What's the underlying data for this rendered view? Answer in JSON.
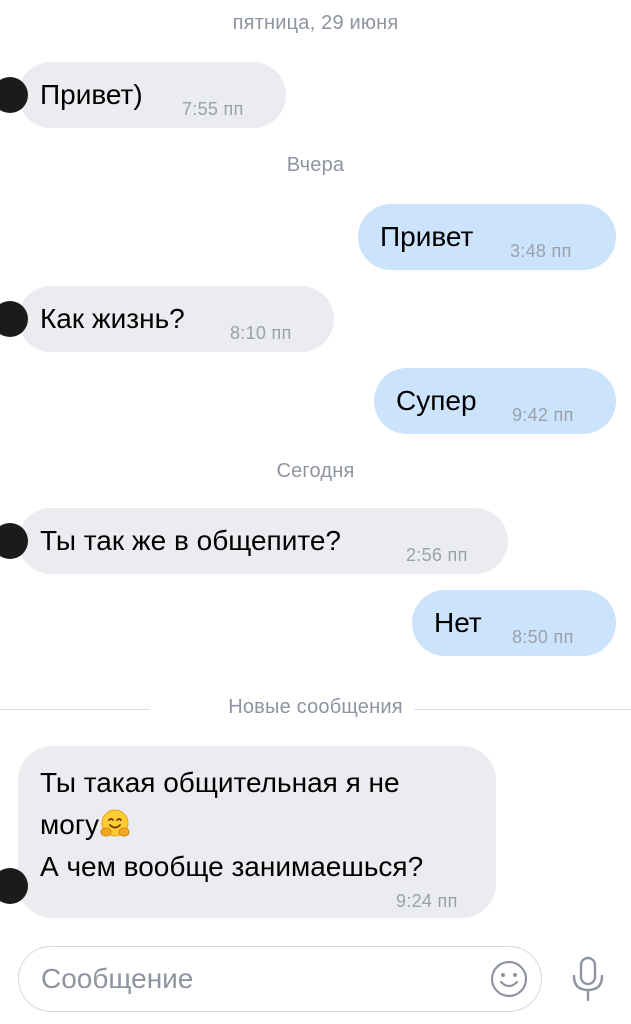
{
  "chat": {
    "separators": {
      "friday": "пятница, 29 июня",
      "yesterday": "Вчера",
      "today": "Сегодня"
    },
    "messages": [
      {
        "text": "Привет)",
        "time": "7:55 пп",
        "direction": "in"
      },
      {
        "text": "Привет",
        "time": "3:48 пп",
        "direction": "out"
      },
      {
        "text": "Как жизнь?",
        "time": "8:10 пп",
        "direction": "in"
      },
      {
        "text": "Супер",
        "time": "9:42 пп",
        "direction": "out"
      },
      {
        "text": "Ты так же в общепите?",
        "time": "2:56 пп",
        "direction": "in"
      },
      {
        "text": "Нет",
        "time": "8:50 пп",
        "direction": "out"
      }
    ],
    "new_messages_label": "Новые сообщения",
    "last_message": {
      "line1": "Ты такая общительная я не",
      "line2": "могу",
      "emoji": "hugging-face-emoji",
      "line3": "А чем вообще занимаешься?",
      "time": "9:24 пп"
    }
  },
  "composer": {
    "placeholder": "Сообщение",
    "emoji_button_icon": "smile-icon",
    "voice_button_icon": "microphone-icon"
  },
  "colors": {
    "incoming_bubble": "#eaecef",
    "outgoing_bubble": "#cce3fc",
    "secondary_text": "#8e95a0"
  }
}
